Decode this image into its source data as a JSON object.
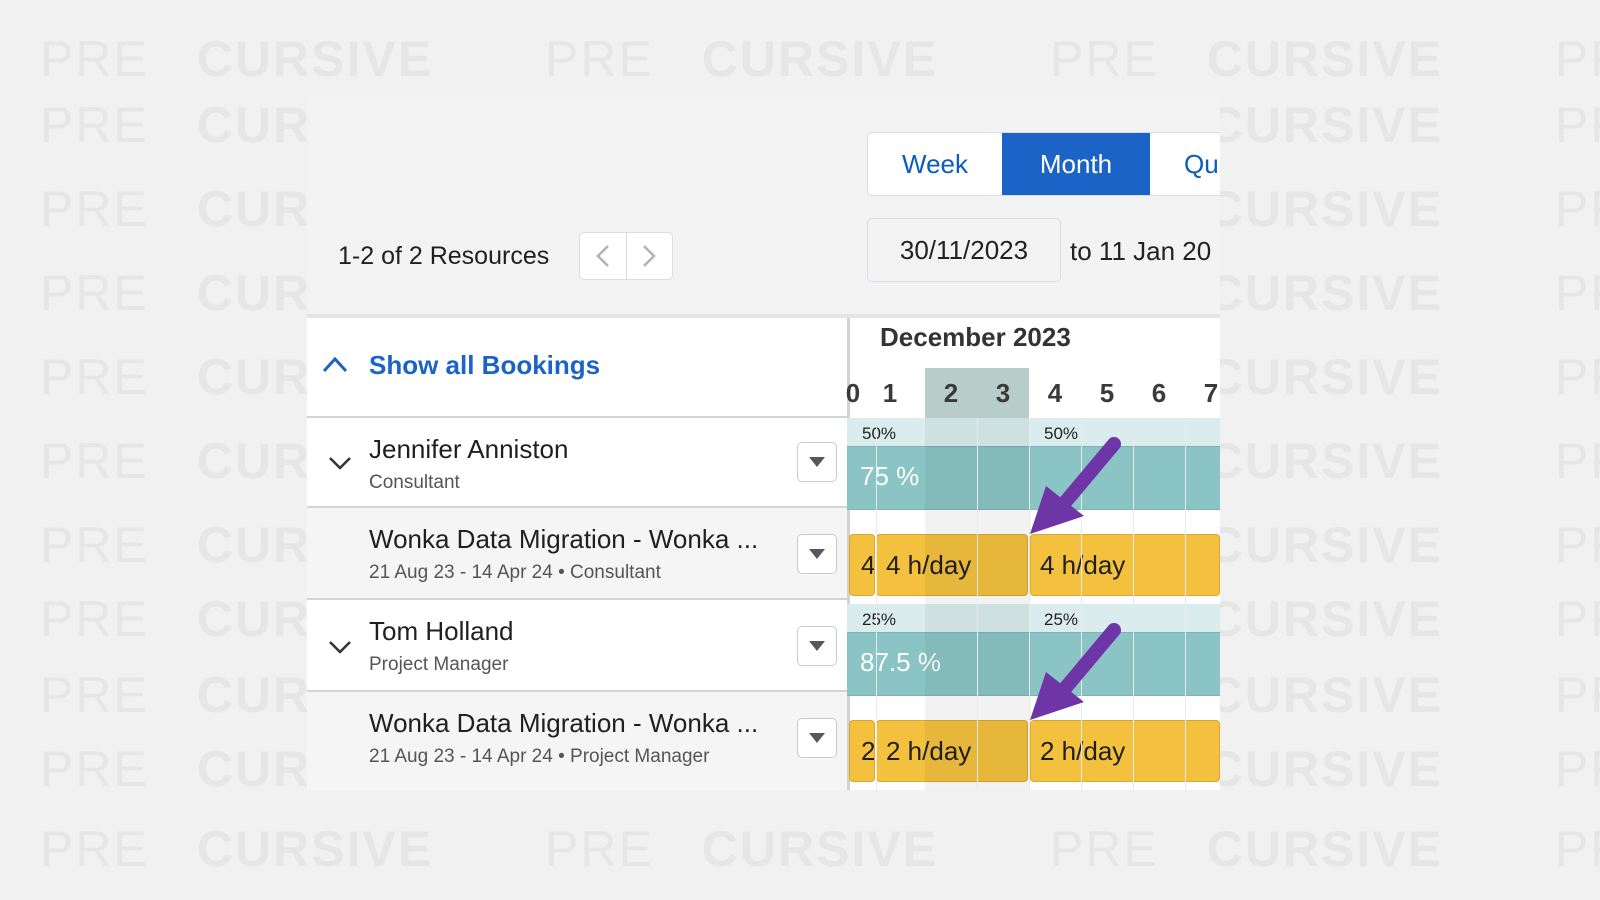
{
  "watermark": {
    "pre": "PRE",
    "rest": "CURSIVE"
  },
  "views": {
    "week": "Week",
    "month": "Month",
    "quarter": "Qu",
    "active": "Month"
  },
  "resources": {
    "count_label": "1-2 of 2 Resources",
    "prev_icon": "chevron-left-icon",
    "next_icon": "chevron-right-icon"
  },
  "date_range": {
    "start": "30/11/2023",
    "end_label": "to 11 Jan 20"
  },
  "bookings_toggle": {
    "label": "Show all Bookings",
    "icon": "chevron-up-icon"
  },
  "calendar": {
    "month": "December 2023",
    "days": [
      "0",
      "1",
      "2",
      "3",
      "4",
      "5",
      "6",
      "7"
    ],
    "weekend_days": [
      "2",
      "3"
    ]
  },
  "rows": [
    {
      "resource": {
        "name": "Jennifer Anniston",
        "role": "Consultant"
      },
      "util_labels": [
        "50%",
        "50%"
      ],
      "capacity_label": "75 %",
      "booking": {
        "title": "Wonka Data Migration - Wonka ...",
        "subtitle": "21 Aug 23 - 14 Apr 24 • Consultant",
        "segments": [
          "4",
          "4 h/day",
          "4 h/day"
        ]
      }
    },
    {
      "resource": {
        "name": "Tom Holland",
        "role": "Project Manager"
      },
      "util_labels": [
        "25%",
        "25%"
      ],
      "capacity_label": "87.5 %",
      "booking": {
        "title": "Wonka Data Migration - Wonka ...",
        "subtitle": "21 Aug 23 - 14 Apr 24 • Project Manager",
        "segments": [
          "2",
          "2 h/day",
          "2 h/day"
        ]
      }
    }
  ],
  "colors": {
    "accent": "#1b63c6",
    "capacity_bar": "#8bc4c5",
    "booking_bar": "#f4c13f",
    "weekend_header": "#b7cdc9",
    "annotation_arrow": "#6e35a6"
  }
}
